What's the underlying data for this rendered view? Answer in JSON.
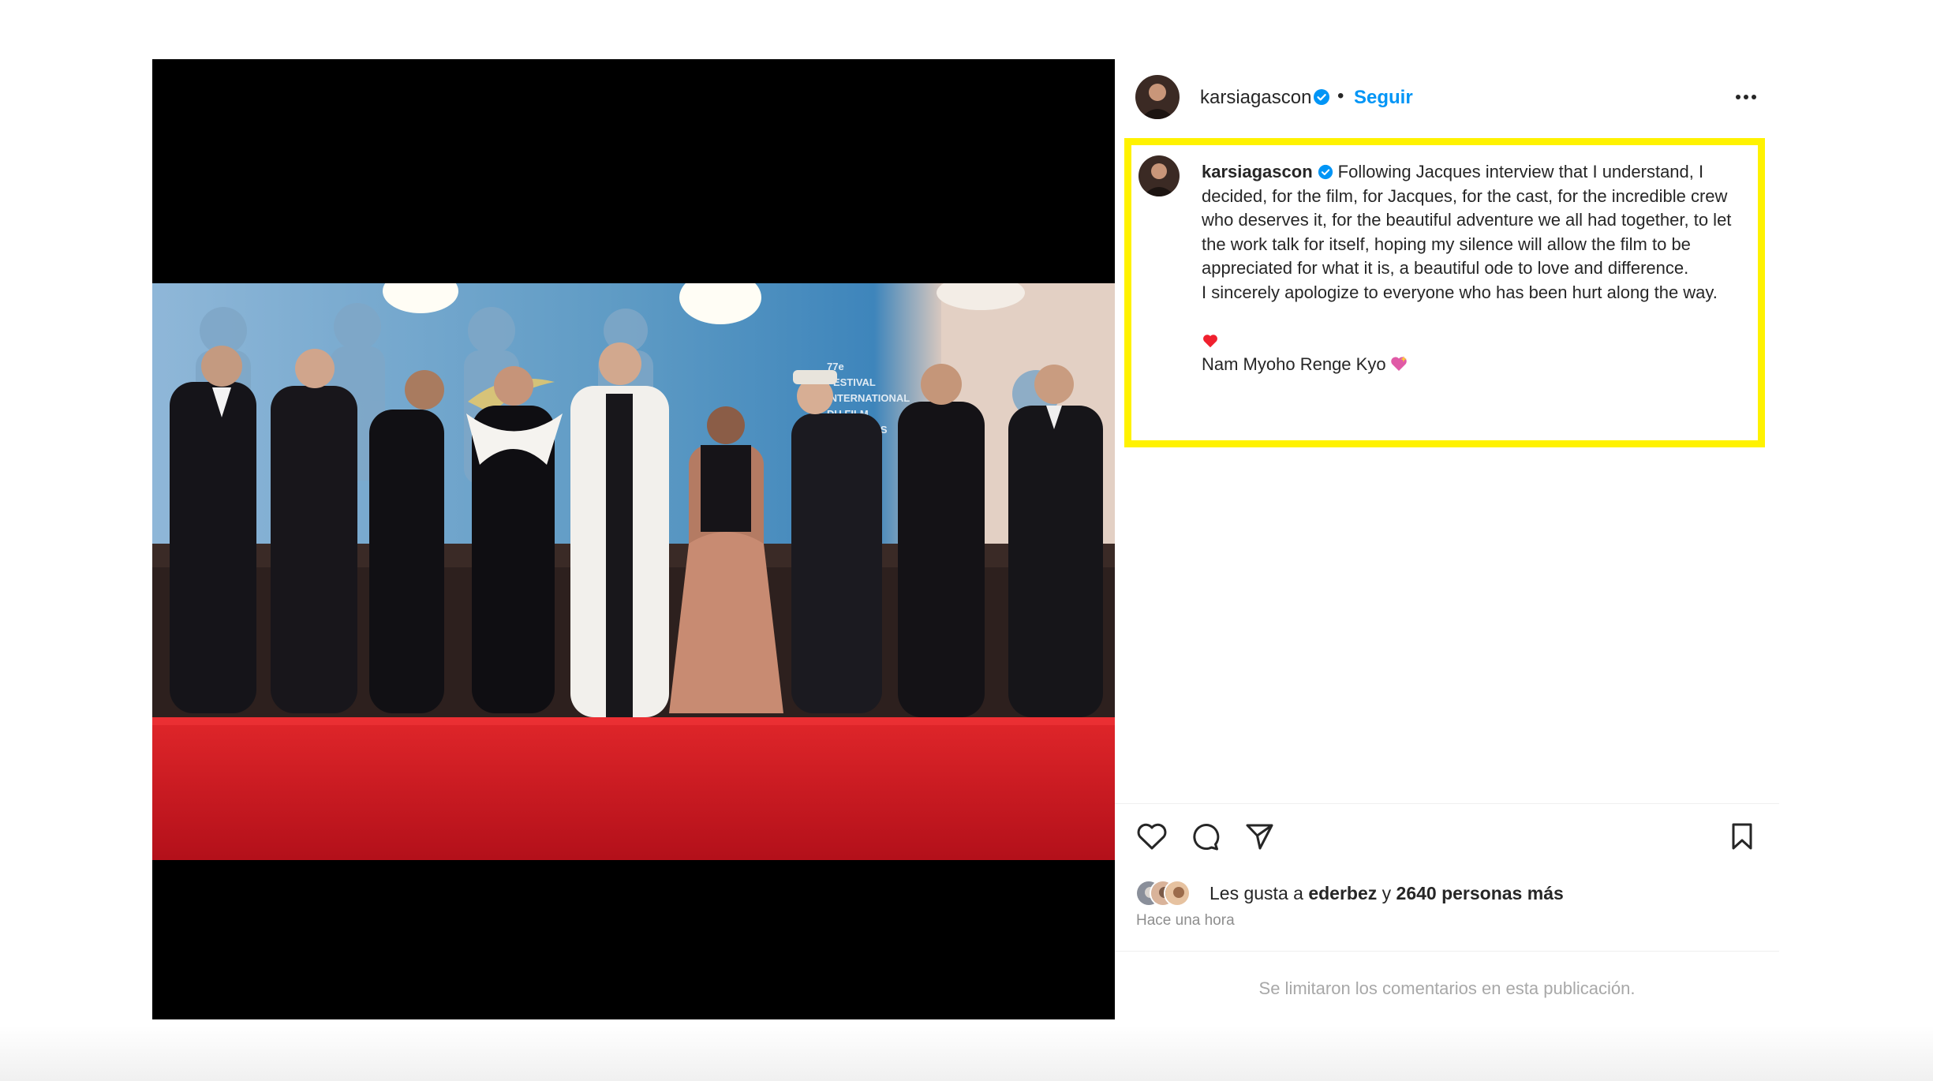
{
  "post": {
    "username": "karsiagascon",
    "follow_label": "Seguir",
    "separator": "•",
    "caption": {
      "username": "karsiagascon",
      "text_1": "Following Jacques interview that I understand, I decided, for the film, for Jacques, for the cast, for the incredible crew who deserves it, for the beautiful adventure we all had together, to let the work talk for itself, hoping my silence will allow the film to be appreciated for what it is, a beautiful ode to love and difference.",
      "text_2": "I sincerely apologize to everyone who has been hurt along the way.",
      "text_3": "Nam Myoho Renge Kyo"
    },
    "likes": {
      "prefix": "Les gusta a",
      "user": "ederbez",
      "conj": "y",
      "others": "2640 personas más"
    },
    "timestamp": "Hace una hora",
    "comments_notice": "Se limitaron los comentarios en esta publicación."
  },
  "photo_backdrop": {
    "festival_lines": [
      "77e",
      "FESTIVAL",
      "INTERNATIONAL",
      "DU FILM",
      "DE CANNES"
    ]
  },
  "icons": [
    "verified-badge-icon",
    "more-options-icon",
    "heart-icon",
    "comment-icon",
    "share-icon",
    "bookmark-icon",
    "red-heart-emoji",
    "sparkling-heart-emoji"
  ],
  "colors": {
    "accent": "#0095f6",
    "highlight": "#fff200",
    "carpet": "#c8141c",
    "backdrop": "#5d9ac4"
  }
}
